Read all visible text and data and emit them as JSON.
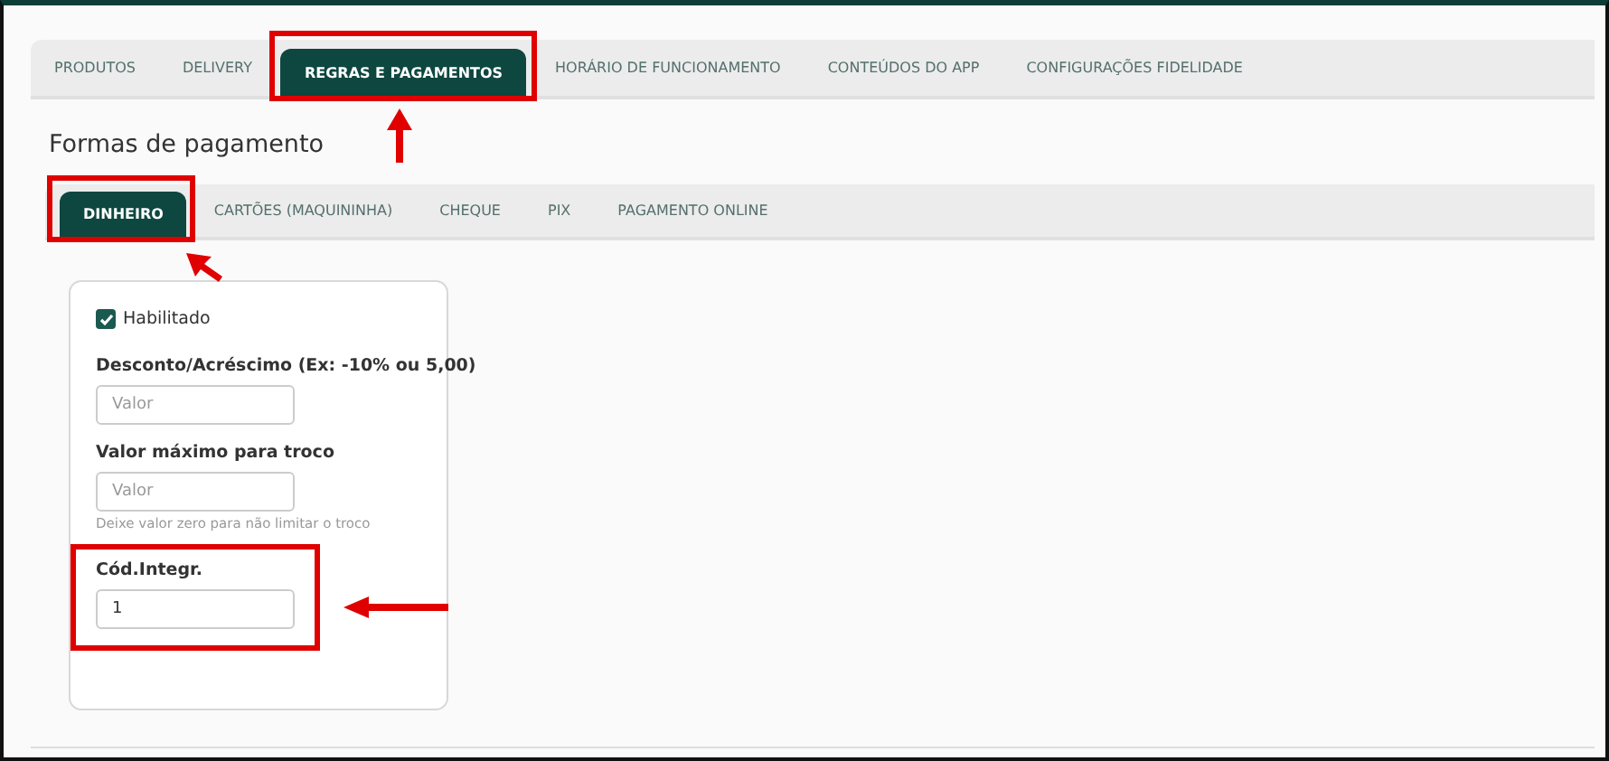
{
  "main_tabs": [
    {
      "label": "PRODUTOS",
      "selected": false,
      "highlighted": false
    },
    {
      "label": "DELIVERY",
      "selected": false,
      "highlighted": false
    },
    {
      "label": "REGRAS E PAGAMENTOS",
      "selected": true,
      "highlighted": true,
      "arrow": true
    },
    {
      "label": "HORÁRIO DE FUNCIONAMENTO",
      "selected": false,
      "highlighted": false
    },
    {
      "label": "CONTEÚDOS DO APP",
      "selected": false,
      "highlighted": false
    },
    {
      "label": "CONFIGURAÇÕES FIDELIDADE",
      "selected": false,
      "highlighted": false
    }
  ],
  "section_title": "Formas de pagamento",
  "payment_tabs": [
    {
      "label": "DINHEIRO",
      "selected": true,
      "highlighted": true,
      "arrow": true
    },
    {
      "label": "CARTÕES (MAQUININHA)",
      "selected": false,
      "highlighted": false
    },
    {
      "label": "CHEQUE",
      "selected": false,
      "highlighted": false
    },
    {
      "label": "PIX",
      "selected": false,
      "highlighted": false
    },
    {
      "label": "PAGAMENTO ONLINE",
      "selected": false,
      "highlighted": false
    }
  ],
  "form": [
    {
      "kind": "checkbox",
      "label": "Habilitado",
      "checked": true
    },
    {
      "kind": "input",
      "label": "Desconto/Acréscimo (Ex: -10% ou 5,00)",
      "placeholder": "Valor",
      "highlighted": false
    },
    {
      "kind": "input",
      "label": "Valor máximo para troco",
      "placeholder": "Valor",
      "hint": "Deixe valor zero para não limitar o troco",
      "highlighted": false
    },
    {
      "kind": "input",
      "label": "Cód.Integr.",
      "value": "1",
      "highlighted": true,
      "arrow": true
    }
  ]
}
